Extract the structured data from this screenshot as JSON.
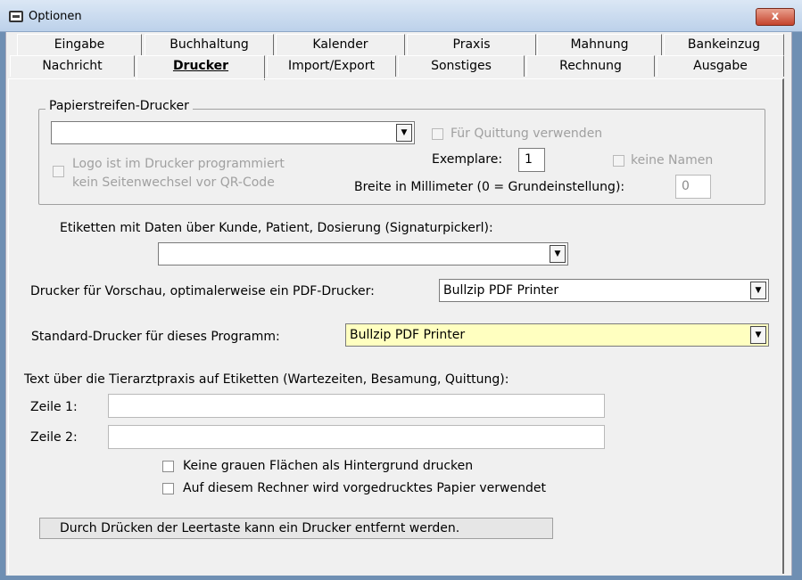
{
  "window": {
    "title": "Optionen",
    "close_label": "x"
  },
  "tabs_row1": [
    "Eingabe",
    "Buchhaltung",
    "Kalender",
    "Praxis",
    "Mahnung",
    "Bankeinzug"
  ],
  "tabs_row2": [
    "Nachricht",
    "Drucker",
    "Import/Export",
    "Sonstiges",
    "Rechnung",
    "Ausgabe"
  ],
  "active_tab": "Drucker",
  "paper_strip": {
    "group_label": "Papierstreifen-Drucker",
    "printer_value": "",
    "for_receipt_label": "Für Quittung verwenden",
    "logo_label_line1": "Logo ist im Drucker programmiert",
    "logo_label_line2": "kein Seitenwechsel vor QR-Code",
    "copies_label": "Exemplare:",
    "copies_value": "1",
    "no_names_label": "keine Namen",
    "width_label": "Breite in Millimeter (0 = Grundeinstellung):",
    "width_value": "0"
  },
  "labels_printer": {
    "label": "Etiketten mit Daten über Kunde, Patient, Dosierung (Signaturpickerl):",
    "value": ""
  },
  "preview_printer": {
    "label": "Drucker für Vorschau, optimalerweise ein PDF-Drucker:",
    "value": "Bullzip PDF Printer"
  },
  "default_printer": {
    "label": "Standard-Drucker für dieses Programm:",
    "value": "Bullzip PDF Printer"
  },
  "practice_text": {
    "heading": "Text über die Tierarztpraxis auf Etiketten (Wartezeiten, Besamung, Quittung):",
    "line1_label": "Zeile 1:",
    "line1_value": "",
    "line2_label": "Zeile 2:",
    "line2_value": ""
  },
  "options": {
    "no_gray_label": "Keine grauen Flächen als Hintergrund drucken",
    "preprinted_label": "Auf diesem Rechner wird vorgedrucktes Papier verwendet"
  },
  "status_text": "Durch Drücken der Leertaste kann ein Drucker entfernt werden.",
  "colors": {
    "highlight_combo": "#ffffc0",
    "close_button": "#c4432c"
  }
}
